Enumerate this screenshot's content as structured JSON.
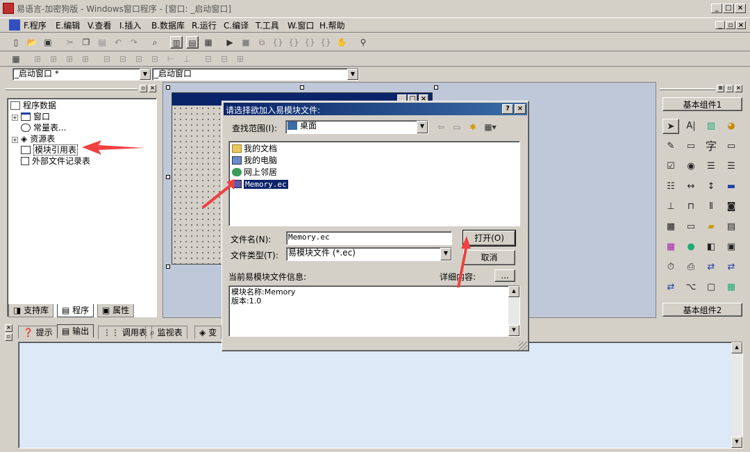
{
  "window": {
    "title": "易语言-加密狗版 - Windows窗口程序 - [窗口: _启动窗口]"
  },
  "menu": {
    "items": [
      {
        "key": "F.",
        "label": "程序"
      },
      {
        "key": "E.",
        "label": "编辑"
      },
      {
        "key": "V.",
        "label": "查看"
      },
      {
        "key": "I.",
        "label": "插入"
      },
      {
        "key": "B.",
        "label": "数据库"
      },
      {
        "key": "R.",
        "label": "运行"
      },
      {
        "key": "C.",
        "label": "编译"
      },
      {
        "key": "T.",
        "label": "工具"
      },
      {
        "key": "W.",
        "label": "窗口"
      },
      {
        "key": "H.",
        "label": "帮助"
      }
    ]
  },
  "combos": {
    "left": "_启动窗口 *",
    "right": "_启动窗口"
  },
  "tree": {
    "root": "程序数据",
    "items": [
      "窗口",
      "常量表...",
      "资源表",
      "模块引用表",
      "外部文件记录表"
    ]
  },
  "left_tabs": [
    "支持库",
    "程序",
    "属性"
  ],
  "bottom_tabs": [
    "提示",
    "输出",
    "调用表",
    "监视表",
    "变"
  ],
  "components": {
    "group1": "基本组件1",
    "group2": "基本组件2"
  },
  "dialog": {
    "title": "请选择欲加入易模块文件:",
    "help_btn": "?",
    "close_btn": "×",
    "lookin_label": "查找范围(I):",
    "lookin_value": "桌面",
    "files": [
      "我的文档",
      "我的电脑",
      "网上邻居",
      "Memory.ec"
    ],
    "filename_label": "文件名(N):",
    "filename_value": "Memory.ec",
    "filetype_label": "文件类型(T):",
    "filetype_value": "易模块文件 (*.ec)",
    "open_button": "打开(O)",
    "cancel_button": "取消",
    "info_label": "当前易模块文件信息:",
    "detail_label": "详细内容:",
    "detail_button": "...",
    "info_line1": "模块名称:Memory",
    "info_line2": "版本:1.0"
  },
  "colors": {
    "titlebar": "#d4d0c8",
    "dialog_title": "#0a246a",
    "selection": "#0a246a",
    "output_bg": "#dce9f7",
    "annotation_arrow": "#f04040"
  }
}
